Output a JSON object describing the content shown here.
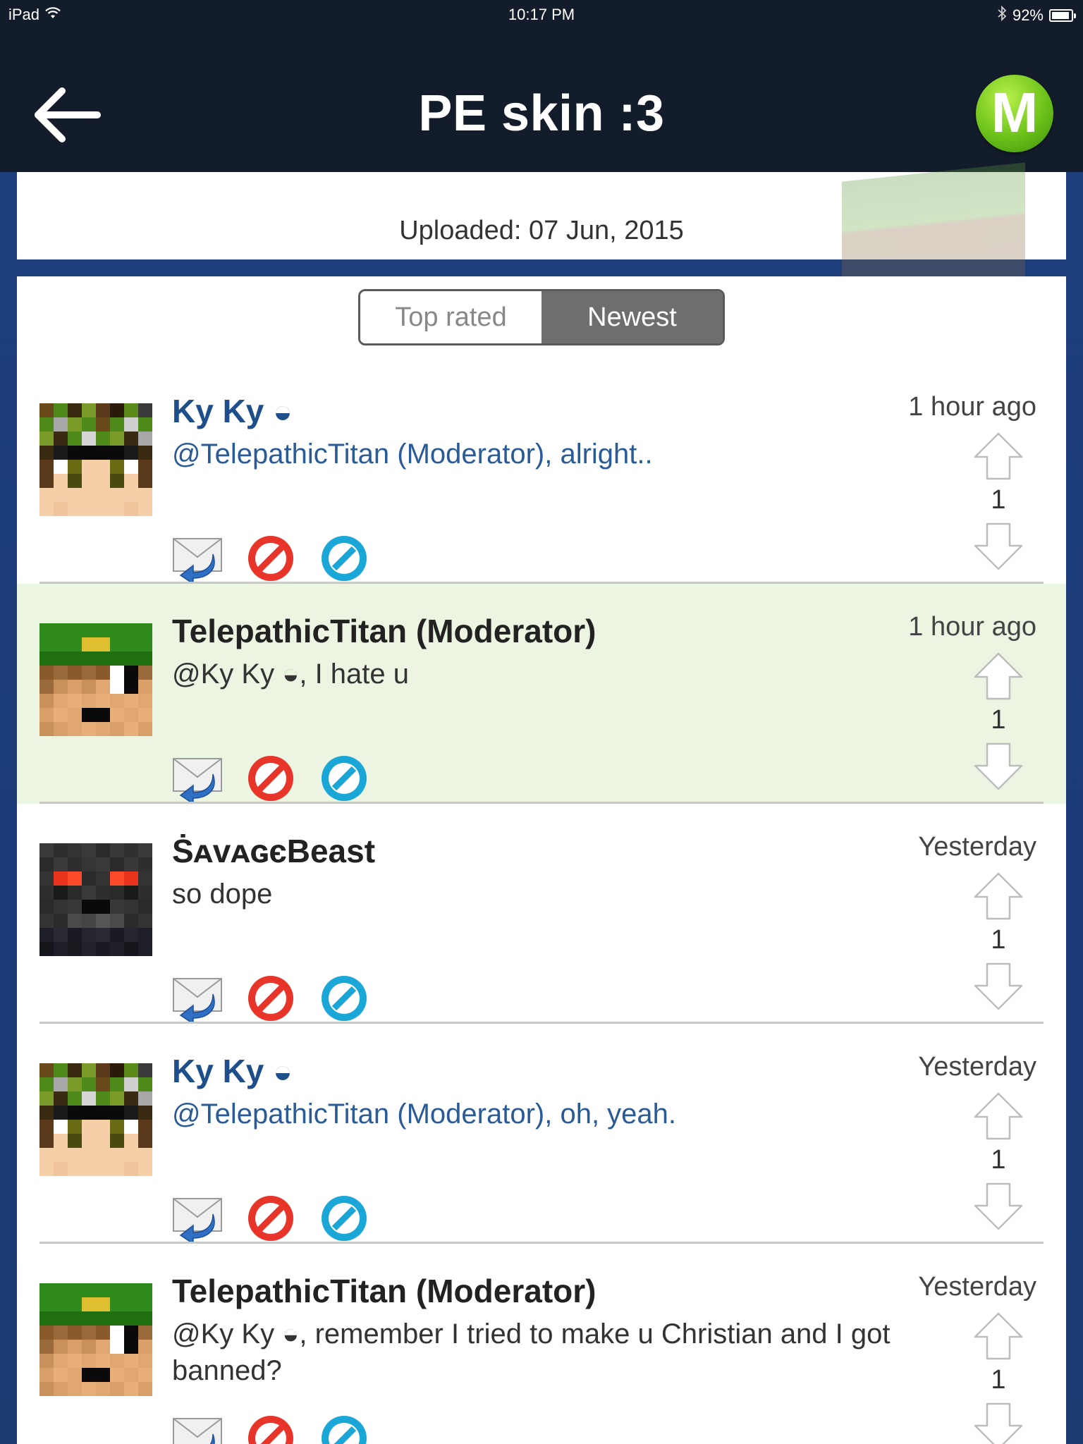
{
  "status_bar": {
    "device": "iPad",
    "time": "10:17 PM",
    "battery_percent": "92%",
    "battery_level": 0.92
  },
  "nav": {
    "title": "PE skin :3",
    "back_icon": "back-arrow-icon",
    "logo_letter": "M"
  },
  "upload": {
    "text": "Uploaded: 07 Jun, 2015"
  },
  "sort": {
    "options": [
      "Top rated",
      "Newest"
    ],
    "selected": "Newest"
  },
  "comments": [
    {
      "author": "Ky Ky ◒",
      "text": "@TelepathicTitan (Moderator), alright..",
      "time": "1 hour ago",
      "score": "1",
      "style": "blue",
      "avatar": "kyky"
    },
    {
      "author": "TelepathicTitan (Moderator)",
      "text": "@Ky Ky ◒, I hate u",
      "time": "1 hour ago",
      "score": "1",
      "style": "dark",
      "avatar": "titan"
    },
    {
      "author": "ṠᴀᴠᴀɢєBeast",
      "text": "so dope",
      "time": "Yesterday",
      "score": "1",
      "style": "dark",
      "avatar": "beast"
    },
    {
      "author": "Ky Ky ◒",
      "text": "@TelepathicTitan (Moderator), oh, yeah.",
      "time": "Yesterday",
      "score": "1",
      "style": "blue",
      "avatar": "kyky"
    },
    {
      "author": "TelepathicTitan (Moderator)",
      "text": "@Ky Ky ◒, remember I tried to make u Christian and I got banned?",
      "time": "Yesterday",
      "score": "1",
      "style": "dark",
      "avatar": "titan"
    }
  ],
  "action_icons": [
    "reply-mail-icon",
    "report-icon",
    "block-icon"
  ],
  "vote_icons": [
    "upvote-arrow-icon",
    "downvote-arrow-icon"
  ],
  "colors": {
    "bar": "#131c2a",
    "highlight": "#ecf5e2",
    "blue_text": "#1e4f8a",
    "report_red": "#e8352a",
    "block_blue": "#1aa7d8",
    "logo_green": "#6cc21a"
  }
}
